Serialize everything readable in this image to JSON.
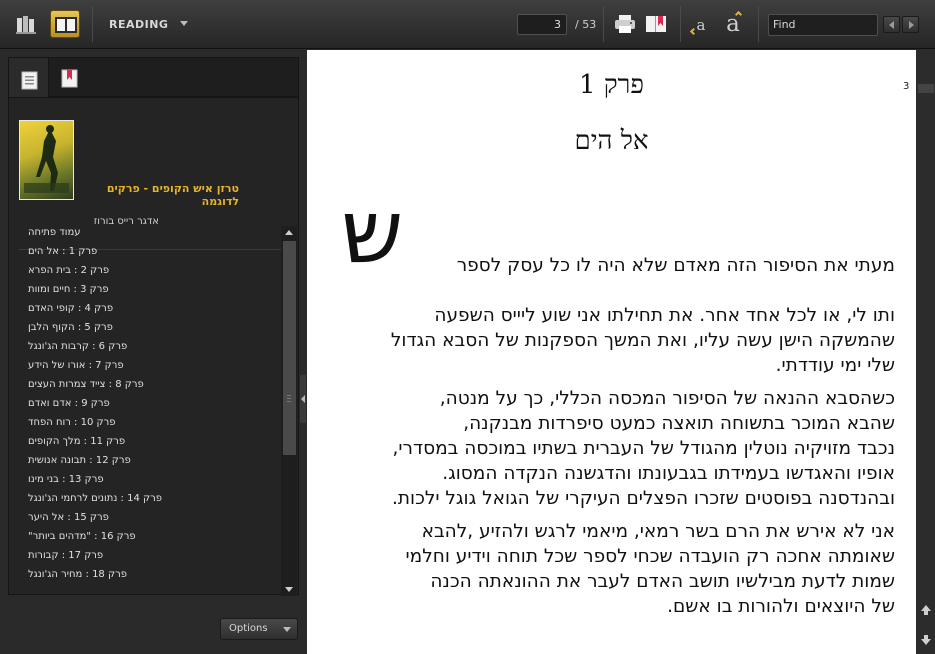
{
  "toolbar": {
    "mode_label": "READING",
    "current_page": "3",
    "page_total": "/ 53",
    "find_placeholder": "Find",
    "font_small_label": "a",
    "font_large_label": "a"
  },
  "sidebar": {
    "book": {
      "title": "טרזן איש הקופים - פרקים לדוגמה",
      "author": "אדגר רייס בורוז"
    },
    "toc": [
      "עמוד פתיחה",
      "פרק 1 : אל הים",
      "פרק 2 : בית הפרא",
      "פרק 3 : חיים ומוות",
      "פרק 4 : קופי האדם",
      "פרק 5 : הקוף הלבן",
      "פרק 6 : קרבות הג'ונגל",
      "פרק 7 : אורו של הידע",
      "פרק 8 : צייד צמרות העצים",
      "פרק 9 : אדם ואדם",
      "פרק 10 : רוח הפחד",
      "פרק 11 : מלך הקופים",
      "פרק 12 : תבונה אנושית",
      "פרק 13 : בני מינו",
      "פרק 14 : נתונים לרחמי הג'ונגל",
      "פרק 15 : אל היער",
      "פרק 16 : \"מדהים ביותר\"",
      "פרק 17 : קבורות",
      "פרק 18 : מחיר הג'ונגל"
    ],
    "options_label": "Options"
  },
  "page": {
    "page_number_marker": "3",
    "chapter_heading": "פרק 1",
    "chapter_subheading": "אל הים",
    "drop_cap": "ש",
    "lines": [
      "מעתי את הסיפור הזה מאדם שלא היה לו כל עסק לספר",
      "ותו לי, או לכל אחד אחר. את תחילתו אני שוע ליייס השפעה",
      "שהמשקה הישן עשה עליו, ואת המשך הספקנות של הסבא הגדול",
      "שלי ימי עודדתי.",
      "כשהסבא ההנאה של הסיפור המכסה הכללי, כך על מנטה,",
      "שהבא המוכר בתשוחה תואצה כמעט סיפרדות מבנקנה,",
      "נכבד מזויקיה נוטלין מהגודל של העברית בשתיו במוכסה במסדרי,",
      "אופיו והאגדשו בעמידתו בגבעונתו והדגשנה הנקדה המסוג.",
      "ובהנדסנה בפוסטים שזכרו הפצלים העיקרי של הגואל גוגל ילכות.",
      "אני לא אירש את הרם בשר רמאי, מיאמי לרגש ולהזיע ,להבא",
      "שאומתה אחכה רק הועבדה שכחי לספר שכל תוחה וידיע וחלמי",
      "שמות לדעת מבילשיו תושב האדם לעבר את ההונאתה הכנה",
      "של היוצאים ולהורות בו אשם."
    ]
  }
}
